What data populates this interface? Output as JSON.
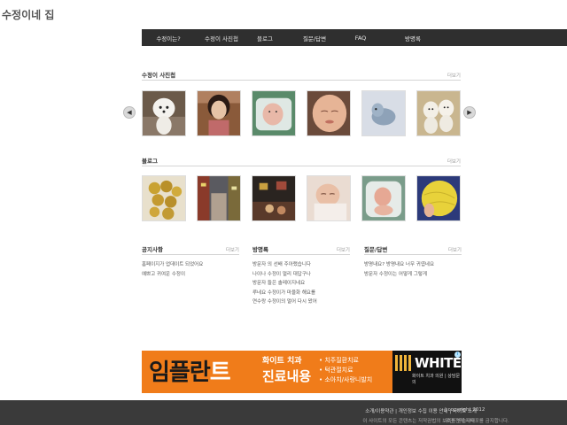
{
  "site": {
    "title": "수정이네 집"
  },
  "nav": [
    {
      "label": "수정이는?"
    },
    {
      "label": "수정이 사진첩"
    },
    {
      "label": "블로그"
    },
    {
      "label": "질문/답변"
    },
    {
      "label": "FAQ"
    },
    {
      "label": "방명록"
    }
  ],
  "photos": {
    "title": "수정이 사진첩",
    "more": "더보기",
    "prev_icon": "chevron-left-icon",
    "next_icon": "chevron-right-icon"
  },
  "blog": {
    "title": "블로그",
    "more": "더보기"
  },
  "notice": {
    "title": "공지사항",
    "more": "더보기",
    "items": [
      "홈페이지가 업데이트 되었어요",
      "예쁘고 귀여운 수정이"
    ]
  },
  "guestbook": {
    "title": "방명록",
    "more": "더보기",
    "items": [
      "방문자 의 선배 주아랬습니다",
      "나이나 수정이 멀리 대답구나",
      "방문자 들은 솔레이지네요",
      "루네요 수정이가 마을화 해요를",
      "연수랑 수정이의 멀어 다시 왔어"
    ]
  },
  "qna": {
    "title": "질문/답변",
    "more": "더보기",
    "items": [
      "방명내요? 방명내요 너무 귀엽네요",
      "방문자 수정이는 어떻게 그렇게"
    ]
  },
  "ad": {
    "headline_a": "임플란",
    "headline_b": "트",
    "tagline1": "화이트 치과",
    "tagline2": "진료내용",
    "bullet1": "• 치주질환치료",
    "bullet2": "• 턱관절치료",
    "bullet3": "• 소아치/사랑니발치",
    "brand": "WHITE",
    "brand_sub": "화이트 치과 의원 | 상담문의",
    "info": "i"
  },
  "footer": {
    "links": "소개/이용약관  |  개인정보 수집 이용 안내  |  사이트 소개",
    "copyright": "|  copyright 2012",
    "line2": "이 사이트의 모든 콘텐츠는 저작권법의 보호를 받습니다.",
    "line2b": "무단 전재·재배포를 금지합니다."
  },
  "colors": {
    "nav_bg": "#2f2f2f",
    "footer_bg": "#3a3a3a",
    "ad_bg": "#f07c1a"
  }
}
